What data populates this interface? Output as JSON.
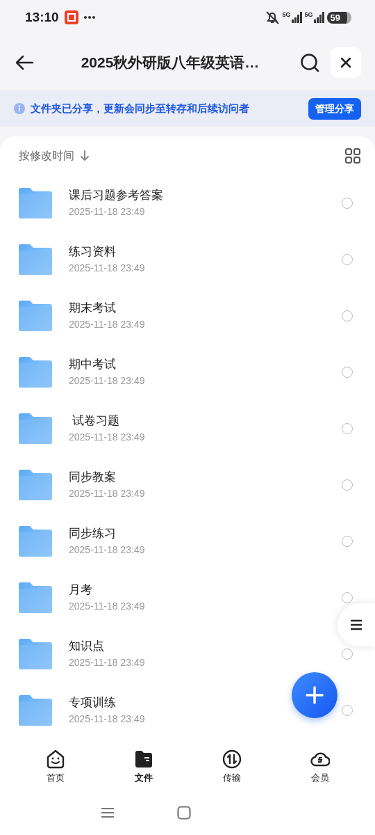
{
  "status_bar": {
    "time": "13:10",
    "network_1": "5G",
    "network_2": "5G",
    "battery": "59"
  },
  "header": {
    "title": "2025秋外研版八年级英语…"
  },
  "banner": {
    "text": "文件夹已分享，更新会同步至转存和后续访问者",
    "button": "管理分享"
  },
  "sort": {
    "label": "按修改时间"
  },
  "files": [
    {
      "name": "课后习题参考答案",
      "date": "2025-11-18 23:49",
      "selected": false
    },
    {
      "name": "练习资料",
      "date": "2025-11-18 23:49",
      "selected": false
    },
    {
      "name": "期末考试",
      "date": "2025-11-18 23:49",
      "selected": false
    },
    {
      "name": "期中考试",
      "date": "2025-11-18 23:49",
      "selected": false
    },
    {
      "name": " 试卷习题",
      "date": "2025-11-18 23:49",
      "selected": false
    },
    {
      "name": "同步教案",
      "date": "2025-11-18 23:49",
      "selected": false
    },
    {
      "name": "同步练习",
      "date": "2025-11-18 23:49",
      "selected": false
    },
    {
      "name": "月考",
      "date": "2025-11-18 23:49",
      "selected": false
    },
    {
      "name": "知识点",
      "date": "2025-11-18 23:49",
      "selected": false
    },
    {
      "name": "专项训练",
      "date": "2025-11-18 23:49",
      "selected": false
    }
  ],
  "tabs": [
    {
      "kind": "home",
      "label": "首页",
      "selected": false
    },
    {
      "kind": "files",
      "label": "文件",
      "selected": true
    },
    {
      "kind": "transfer",
      "label": "传输",
      "selected": false
    },
    {
      "kind": "member",
      "label": "会员",
      "selected": false
    }
  ]
}
